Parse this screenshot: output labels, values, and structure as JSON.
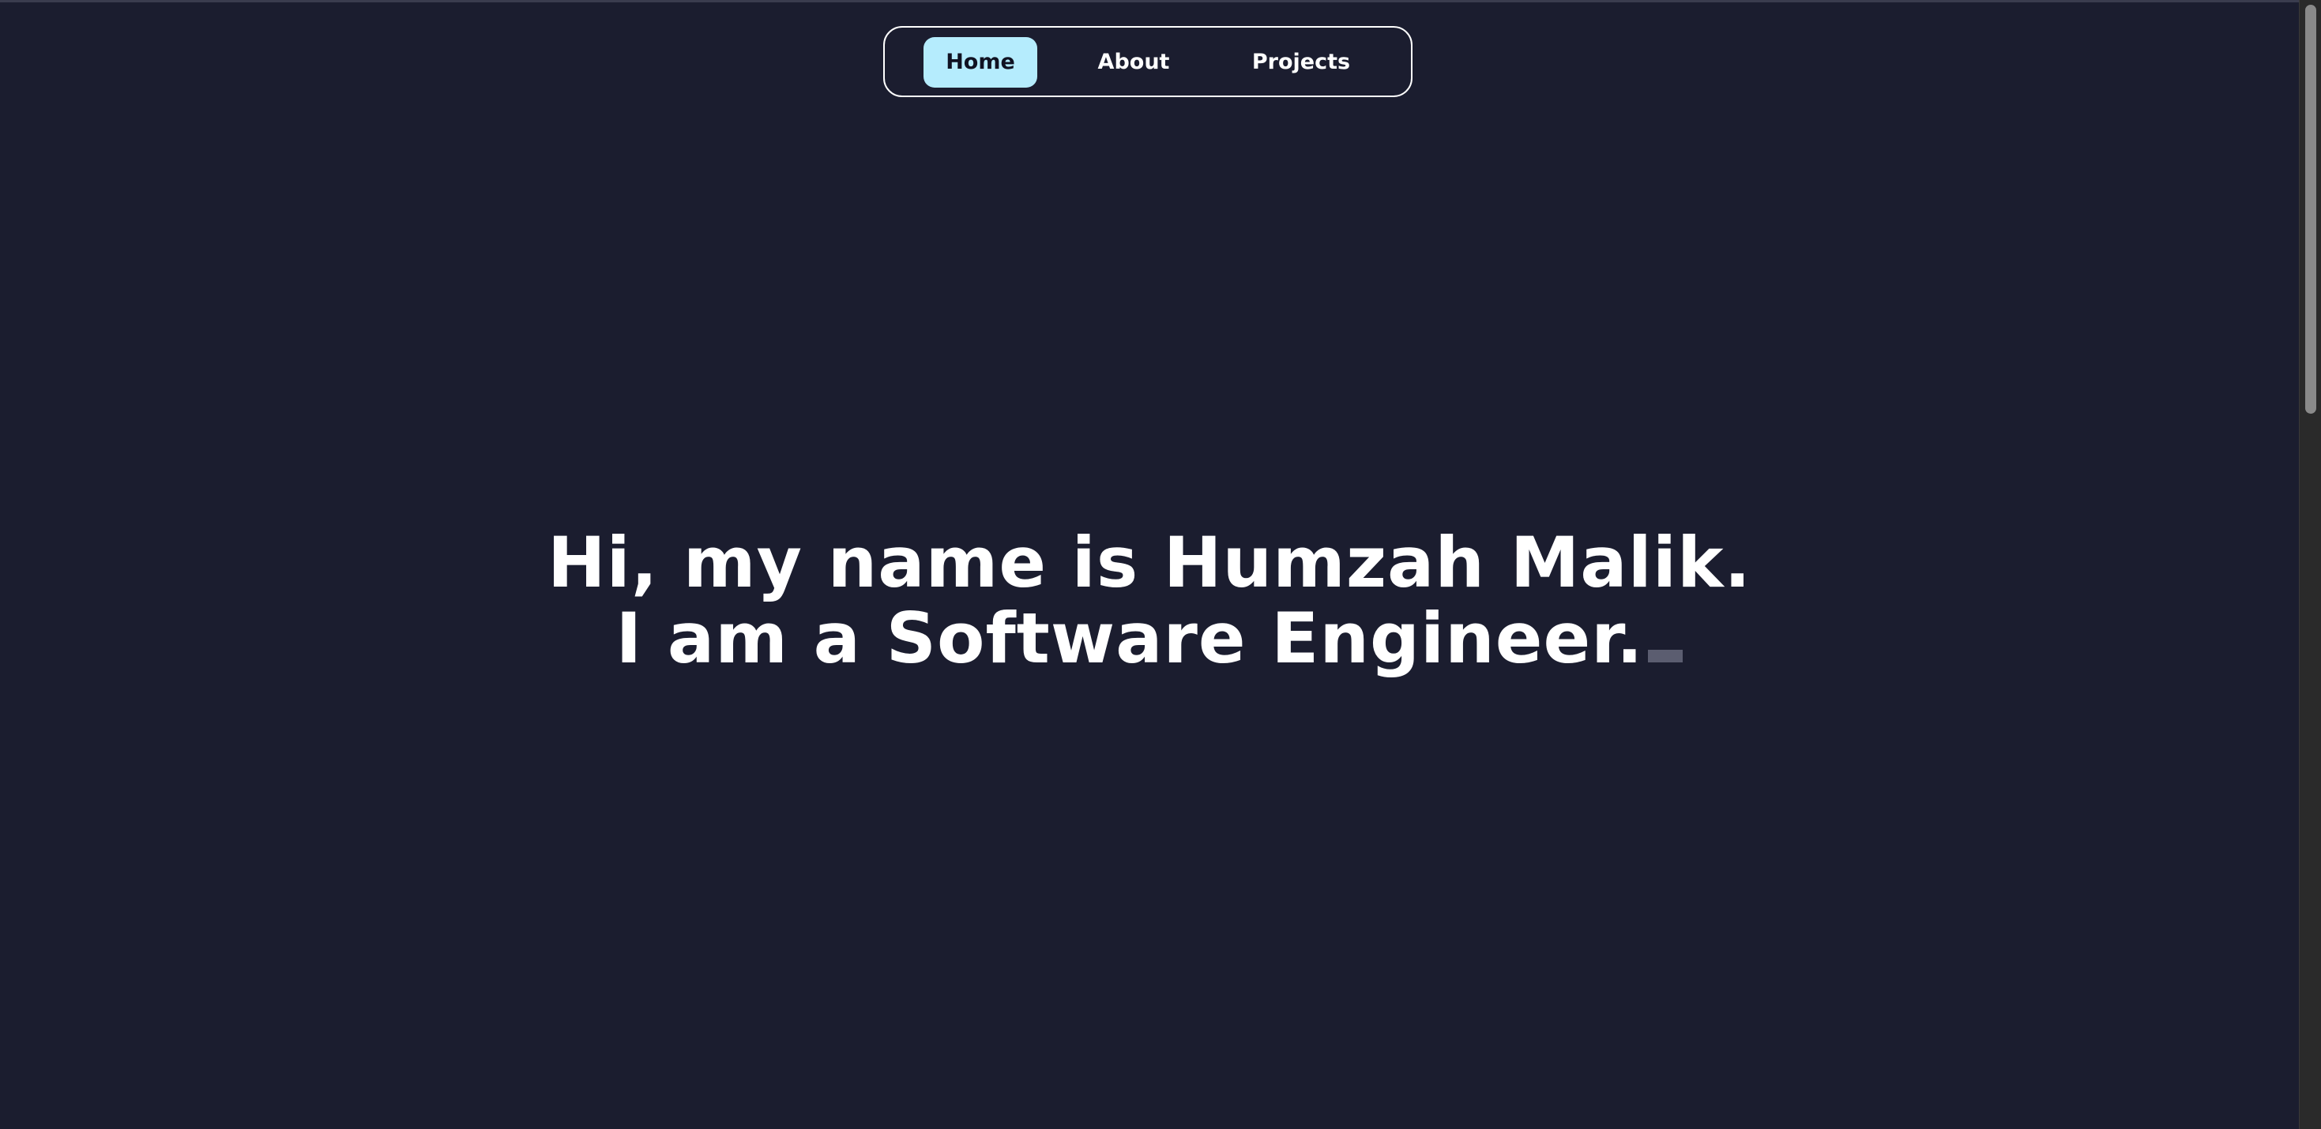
{
  "nav": {
    "items": [
      {
        "label": "Home",
        "active": true
      },
      {
        "label": "About",
        "active": false
      },
      {
        "label": "Projects",
        "active": false
      }
    ]
  },
  "hero": {
    "line1": "Hi, my name is Humzah Malik.",
    "line2": "I am a Software Engineer."
  },
  "colors": {
    "background": "#1b1d2f",
    "accent": "#b5ecfd",
    "text": "#ffffff"
  }
}
